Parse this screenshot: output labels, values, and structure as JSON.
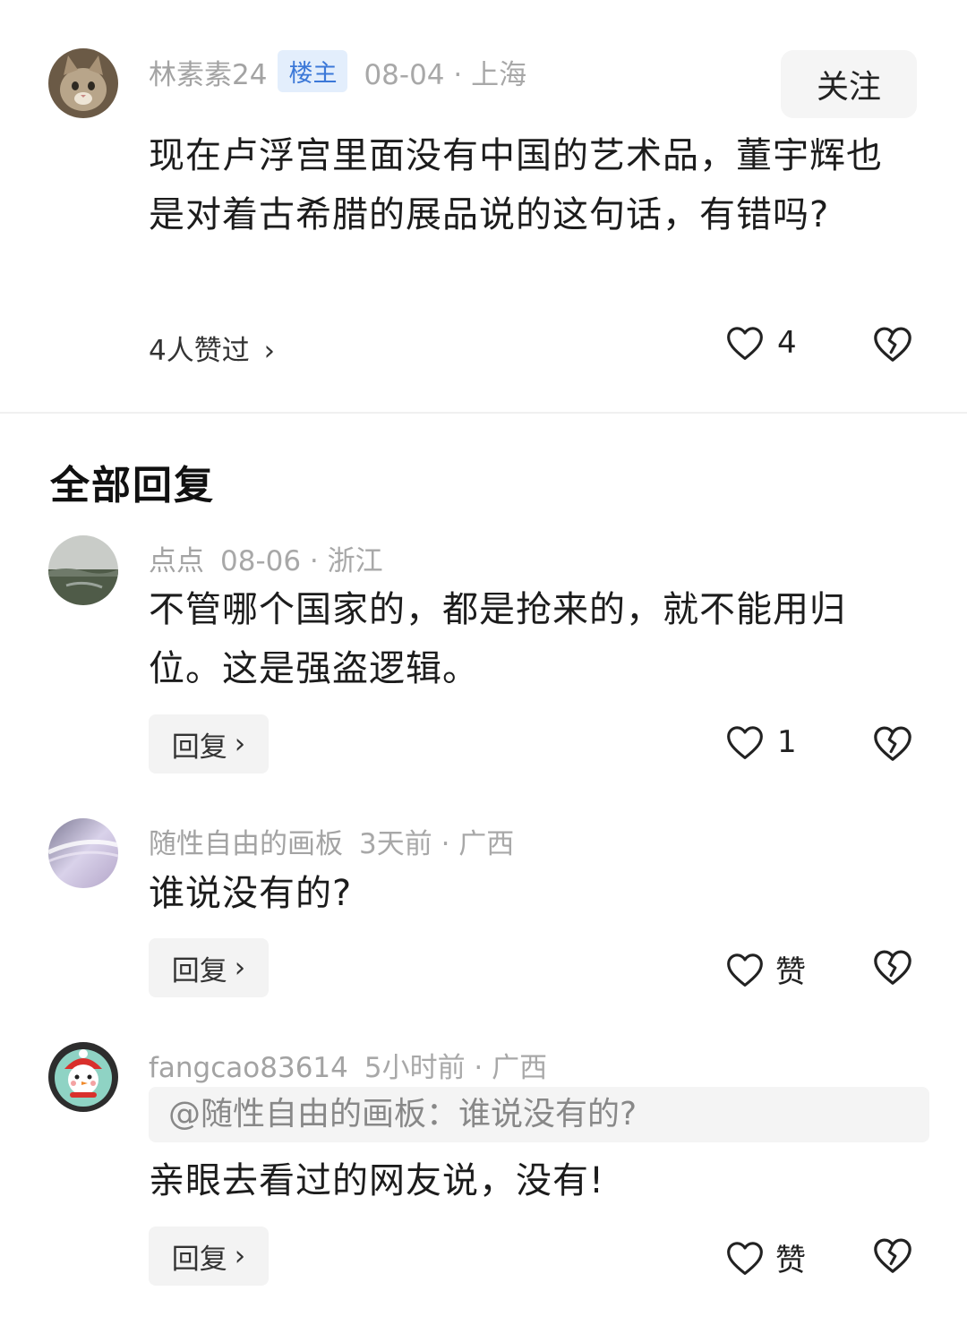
{
  "post": {
    "author": "林素素24",
    "badge": "楼主",
    "date_location": "08-04 · 上海",
    "follow_label": "关注",
    "content": "现在卢浮宫里面没有中国的艺术品，董宇辉也是对着古希腊的展品说的这句话，有错吗?",
    "likers_text": "4人赞过",
    "likers_chevron": "›",
    "like_count": "4"
  },
  "section_title": "全部回复",
  "replies": [
    {
      "author": "点点",
      "date_location": "08-06 · 浙江",
      "content": "不管哪个国家的，都是抢来的，就不能用归位。这是强盗逻辑。",
      "reply_label": "回复",
      "chevron": "›",
      "like_label": "1"
    },
    {
      "author": "随性自由的画板",
      "date_location": "3天前 · 广西",
      "content": "谁说没有的?",
      "reply_label": "回复",
      "chevron": "›",
      "like_label": "赞"
    },
    {
      "author": "fangcao83614",
      "date_location": "5小时前 · 广西",
      "quote": "@随性自由的画板：谁说没有的?",
      "content": "亲眼去看过的网友说，没有!",
      "reply_label": "回复",
      "chevron": "›",
      "like_label": "赞"
    }
  ],
  "icons": {
    "heart": "heart-icon",
    "dislike": "broken-heart-icon",
    "chevron": "chevron-right-icon"
  }
}
